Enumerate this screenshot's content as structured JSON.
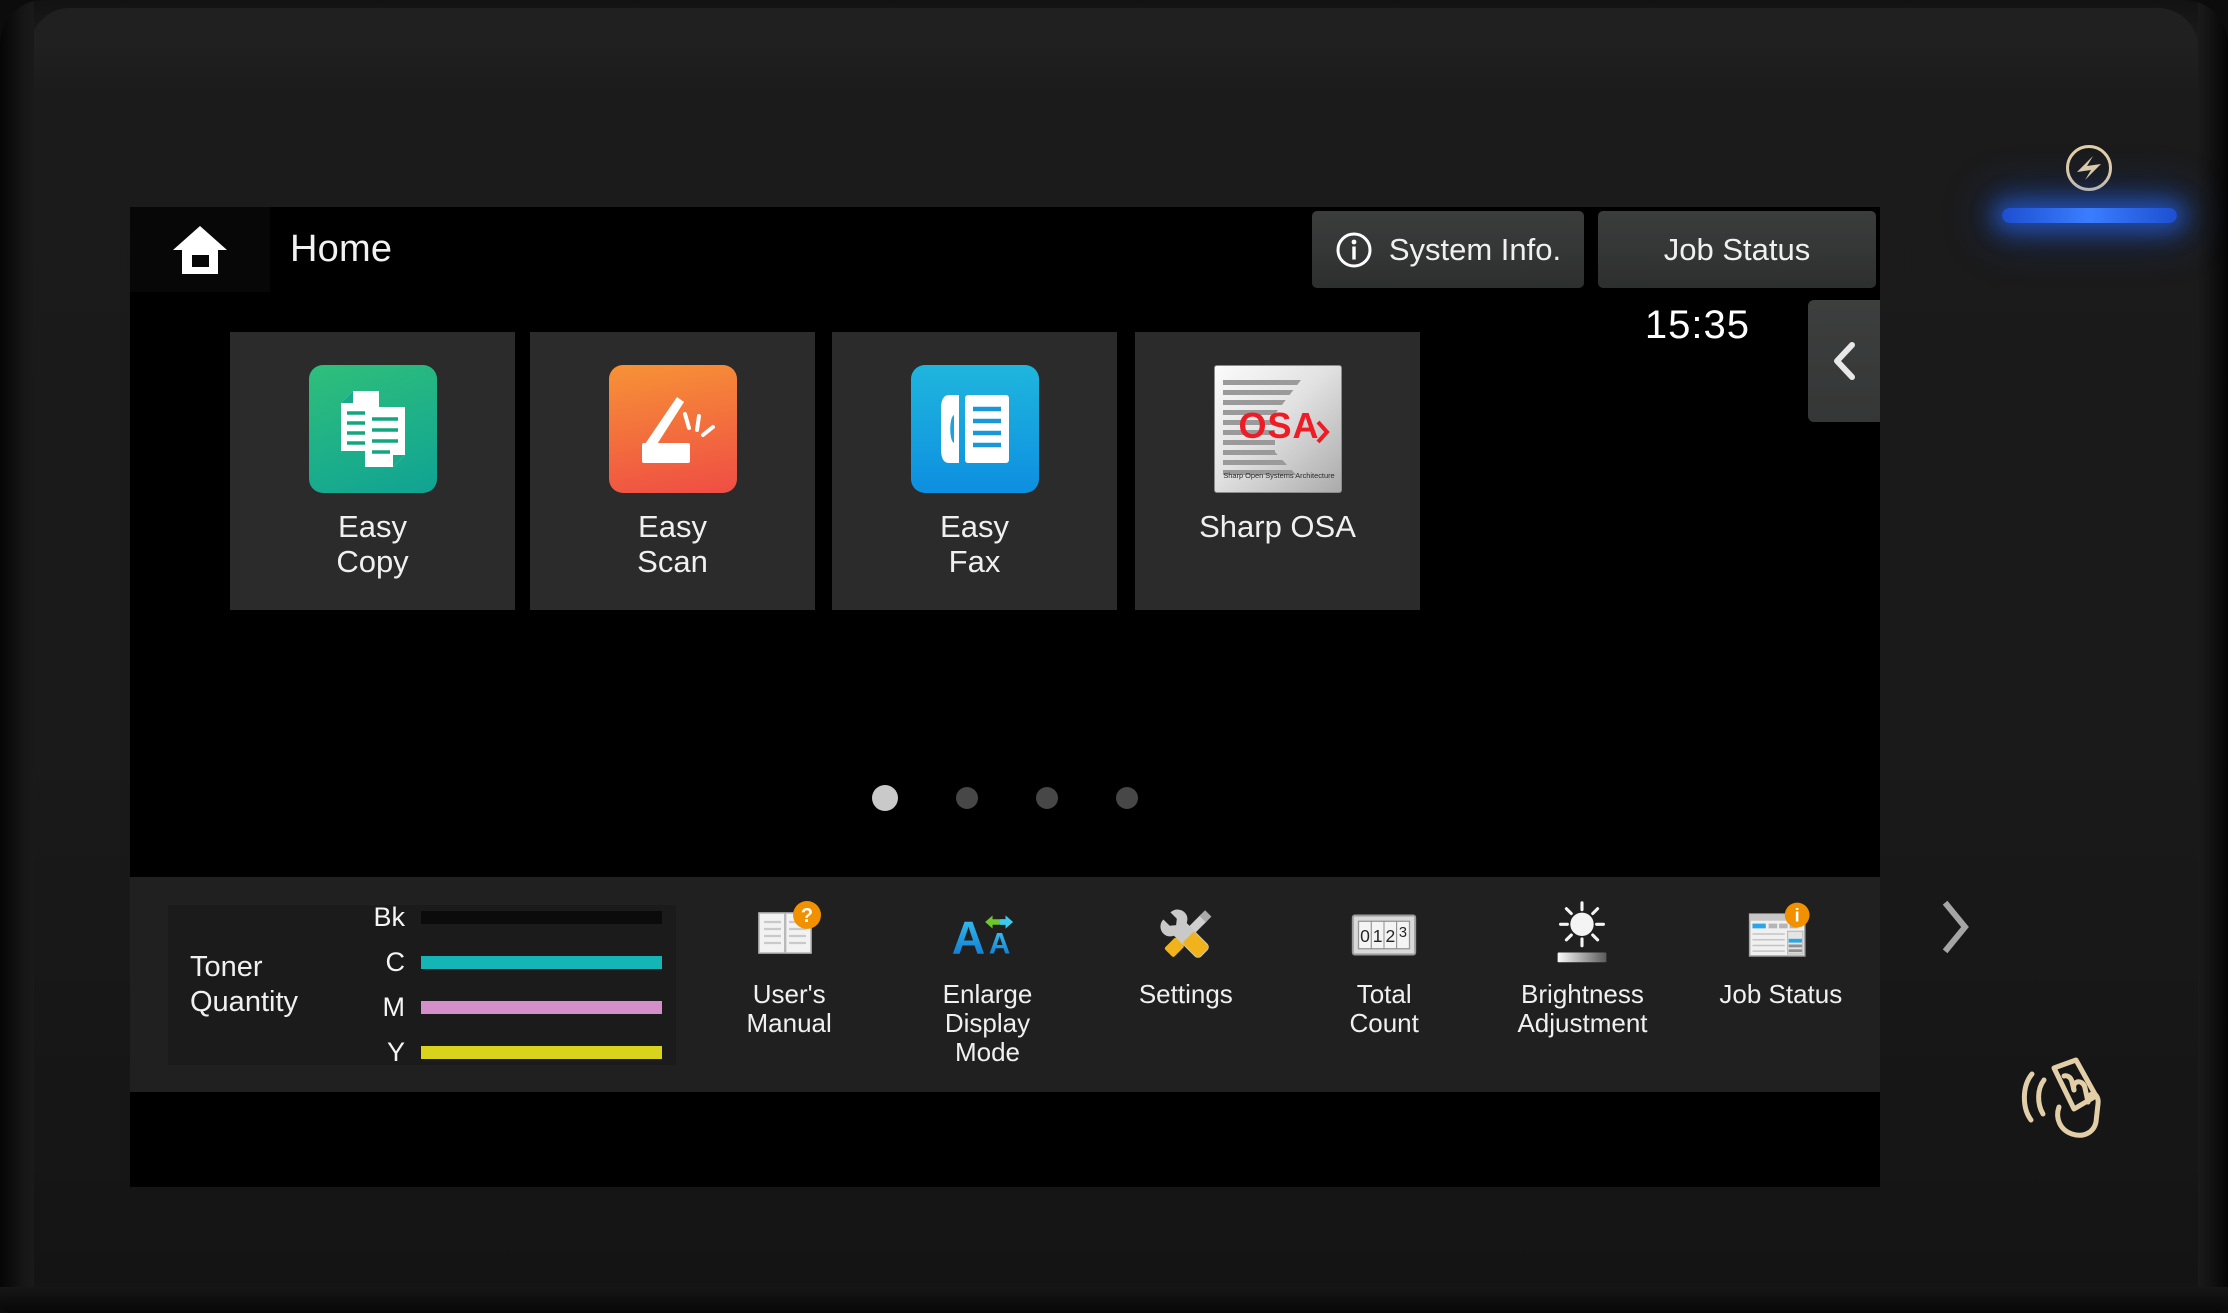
{
  "header": {
    "home_icon": "home-icon",
    "title": "Home",
    "system_info_label": "System Info.",
    "system_info_icon": "info-circle-icon",
    "job_status_label": "Job Status",
    "clock": "15:35",
    "collapse_icon": "chevron-left-icon"
  },
  "carousel": {
    "next_icon": "chevron-right-icon",
    "apps": [
      {
        "label": "Easy\nCopy",
        "label_line1": "Easy",
        "label_line2": "Copy",
        "icon": "copy-documents-icon",
        "color_start": "#2fbf7a",
        "color_end": "#0fa394"
      },
      {
        "label": "Easy\nScan",
        "label_line1": "Easy",
        "label_line2": "Scan",
        "icon": "scanner-icon",
        "color_start": "#f79236",
        "color_end": "#ef4d44"
      },
      {
        "label": "Easy\nFax",
        "label_line1": "Easy",
        "label_line2": "Fax",
        "icon": "fax-handset-icon",
        "color_start": "#1fb6dd",
        "color_end": "#0d8fe0"
      },
      {
        "label": "Sharp OSA",
        "label_line1": "Sharp OSA",
        "label_line2": "",
        "icon": "sharp-osa-logo-icon",
        "color_start": "#f2f2f2",
        "color_end": "#b8b8b8",
        "logo_text": "OSA",
        "logo_caption": "Sharp Open Systems Architecture",
        "logo_text_color": "#ee1c25"
      }
    ],
    "page_dots": {
      "count": 4,
      "active_index": 0
    }
  },
  "toner": {
    "title_line1": "Toner",
    "title_line2": "Quantity",
    "levels": [
      {
        "key": "Bk",
        "color": "#0b0b0b",
        "percent": 100
      },
      {
        "key": "C",
        "color": "#16b5b5",
        "percent": 100
      },
      {
        "key": "M",
        "color": "#d58fc8",
        "percent": 100
      },
      {
        "key": "Y",
        "color": "#d9d31c",
        "percent": 100
      }
    ]
  },
  "utilities": [
    {
      "icon": "book-question-icon",
      "label_line1": "User's",
      "label_line2": "Manual",
      "label_line3": ""
    },
    {
      "icon": "enlarge-text-icon",
      "label_line1": "Enlarge",
      "label_line2": "Display",
      "label_line3": "Mode"
    },
    {
      "icon": "tools-icon",
      "label_line1": "Settings",
      "label_line2": "",
      "label_line3": ""
    },
    {
      "icon": "counter-icon",
      "label_line1": "Total",
      "label_line2": "Count",
      "label_line3": "",
      "counter_digits": "0123"
    },
    {
      "icon": "brightness-sun-icon",
      "label_line1": "Brightness",
      "label_line2": "Adjustment",
      "label_line3": ""
    },
    {
      "icon": "job-status-info-icon",
      "label_line1": "Job Status",
      "label_line2": "",
      "label_line3": ""
    }
  ],
  "hardware": {
    "power_icon": "power-button-icon",
    "power_led_color": "#3b7dff",
    "nfc_icon": "nfc-card-reader-icon"
  }
}
